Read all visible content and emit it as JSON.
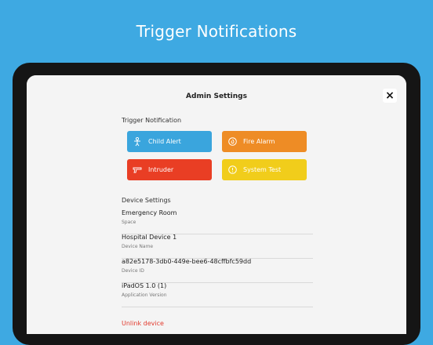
{
  "hero": {
    "title": "Trigger Notifications"
  },
  "sheet": {
    "title": "Admin Settings",
    "close_icon": "×"
  },
  "trigger": {
    "label": "Trigger Notification",
    "buttons": [
      {
        "label": "Child Alert",
        "icon": "child-icon",
        "color": "#3aa5dd"
      },
      {
        "label": "Fire Alarm",
        "icon": "fire-icon",
        "color": "#ee8c25"
      },
      {
        "label": "Intruder",
        "icon": "gun-icon",
        "color": "#e93e24"
      },
      {
        "label": "System Test",
        "icon": "info-icon",
        "color": "#f1cd1b"
      }
    ]
  },
  "device_settings": {
    "label": "Device Settings",
    "rows": [
      {
        "value": "Emergency Room",
        "label": "Space"
      },
      {
        "value": "Hospital Device 1",
        "label": "Device Name"
      },
      {
        "value": "a82e5178-3db0-449e-bee6-48cffbfc59dd",
        "label": "Device ID"
      },
      {
        "value": "iPadOS 1.0 (1)",
        "label": "Application Version"
      }
    ]
  },
  "unlink": {
    "label": "Unlink device"
  },
  "colors": {
    "background": "#3ea9e2",
    "destructive": "#e23b2e"
  }
}
